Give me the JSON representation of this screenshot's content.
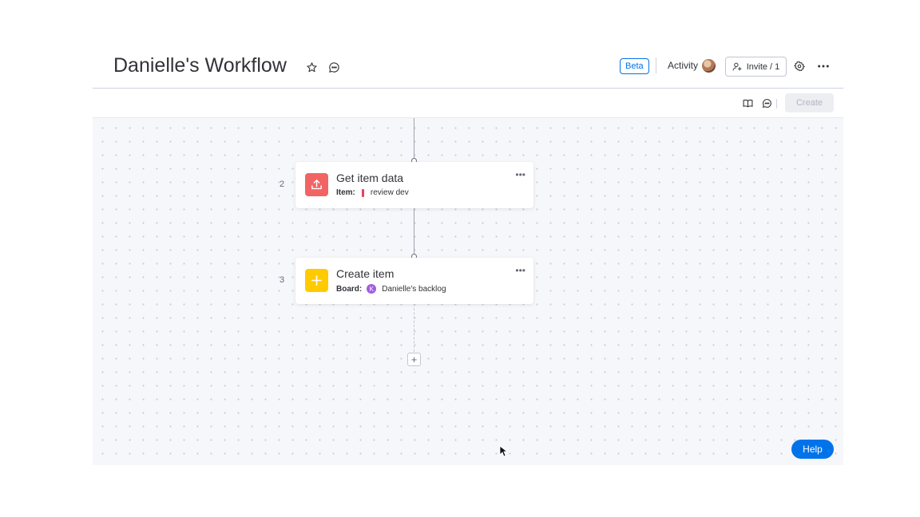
{
  "header": {
    "title": "Danielle's Workflow",
    "beta_label": "Beta",
    "activity_label": "Activity",
    "invite_label": "Invite / 1",
    "icons": [
      "star-icon",
      "chat-icon",
      "user-add-icon",
      "gear-icon",
      "more-icon"
    ]
  },
  "toolbar": {
    "create_label": "Create",
    "icons": [
      "book-icon",
      "chat-icon"
    ]
  },
  "steps": [
    {
      "number": "2",
      "title": "Get item data",
      "sub_label": "Item:",
      "sub_value": "review dev",
      "icon": "upload-icon",
      "icon_color": "#f26464",
      "marker_color": "#e2445c"
    },
    {
      "number": "3",
      "title": "Create item",
      "sub_label": "Board:",
      "sub_value": "Danielle's backlog",
      "badge": "K",
      "icon": "plus-icon",
      "icon_color": "#ffcb00",
      "badge_color": "#a25ddc"
    }
  ],
  "add_step_symbol": "+",
  "help_label": "Help",
  "colors": {
    "accent": "#0073ea",
    "canvas": "#f6f7fb"
  }
}
